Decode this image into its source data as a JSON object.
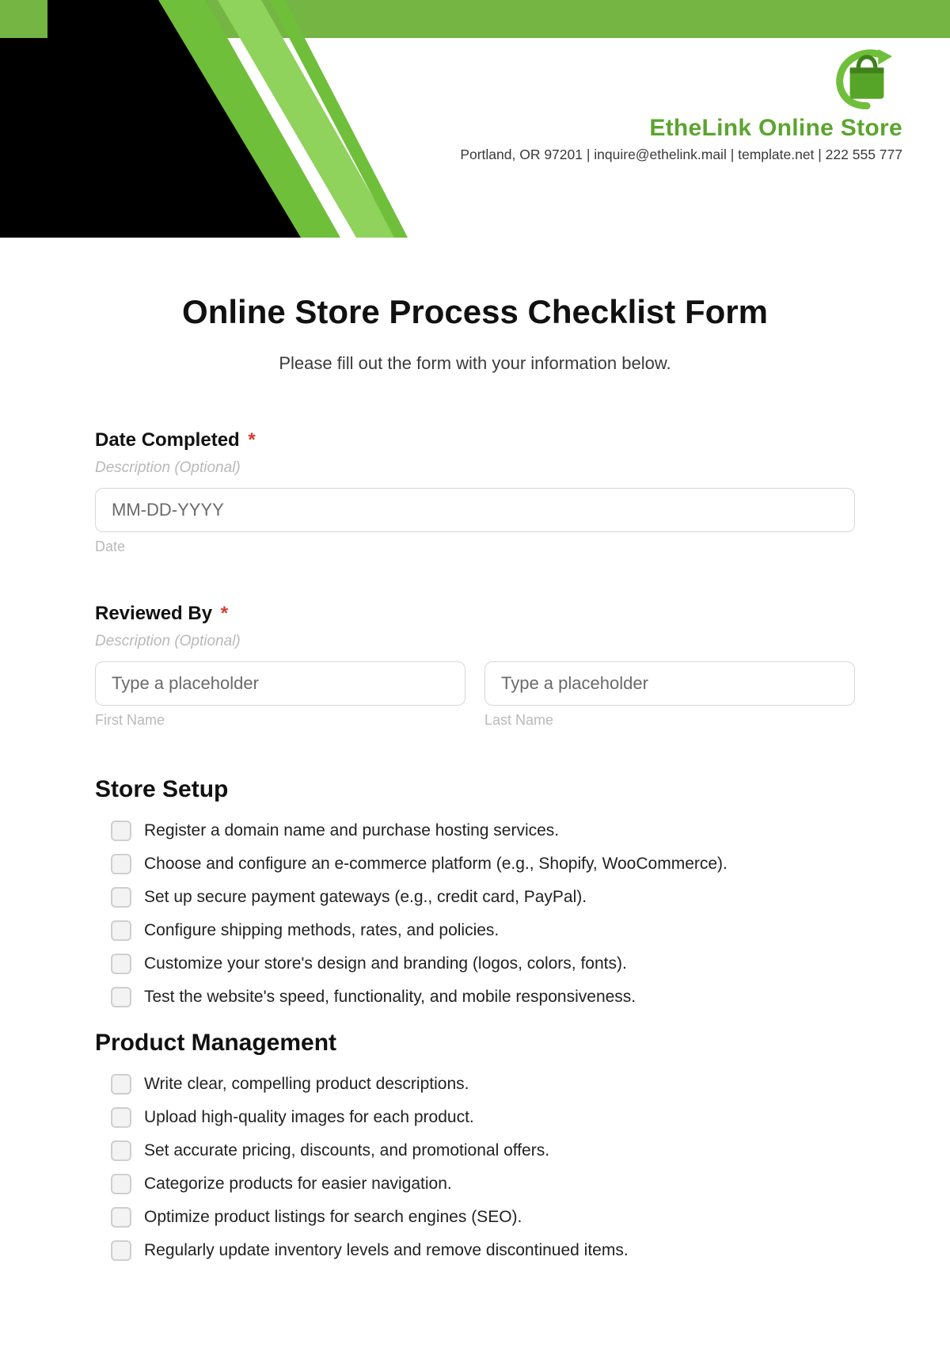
{
  "brand": {
    "name": "EtheLink Online Store",
    "contact": "Portland, OR 97201 | inquire@ethelink.mail | template.net | 222 555 777"
  },
  "form": {
    "title": "Online Store Process Checklist Form",
    "subtitle": "Please fill out the form with your information below.",
    "date_field": {
      "label": "Date Completed",
      "required_mark": "*",
      "description": "Description (Optional)",
      "placeholder": "MM-DD-YYYY",
      "sublabel": "Date"
    },
    "reviewed_field": {
      "label": "Reviewed By",
      "required_mark": "*",
      "description": "Description (Optional)",
      "first_placeholder": "Type a placeholder",
      "first_sublabel": "First Name",
      "last_placeholder": "Type a placeholder",
      "last_sublabel": "Last Name"
    }
  },
  "sections": {
    "store_setup": {
      "title": "Store Setup",
      "items": [
        "Register a domain name and purchase hosting services.",
        "Choose and configure an e-commerce platform (e.g., Shopify, WooCommerce).",
        "Set up secure payment gateways (e.g., credit card, PayPal).",
        "Configure shipping methods, rates, and policies.",
        "Customize your store's design and branding (logos, colors, fonts).",
        "Test the website's speed, functionality, and mobile responsiveness."
      ]
    },
    "product_mgmt": {
      "title": "Product Management",
      "items": [
        "Write clear, compelling product descriptions.",
        "Upload high-quality images for each product.",
        "Set accurate pricing, discounts, and promotional offers.",
        "Categorize products for easier navigation.",
        "Optimize product listings for search engines (SEO).",
        "Regularly update inventory levels and remove discontinued items."
      ]
    }
  }
}
